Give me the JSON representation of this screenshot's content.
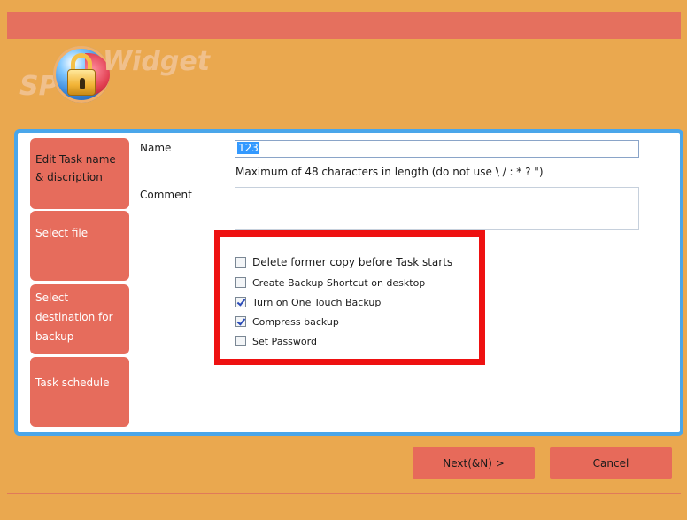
{
  "logo": {
    "text_left": "SP",
    "text_right": "Widget",
    "icon": "lock-icon"
  },
  "sidebar": {
    "items": [
      {
        "label": "Edit Task name & discription",
        "active": true
      },
      {
        "label": "Select file",
        "active": false
      },
      {
        "label": "Select destination for backup",
        "active": false
      },
      {
        "label": "Task schedule",
        "active": false
      }
    ]
  },
  "form": {
    "name_label": "Name",
    "name_value": "123",
    "name_hint": "Maximum of 48 characters in length (do not use \\ / : * ? \")",
    "comment_label": "Comment",
    "comment_value": ""
  },
  "options": [
    {
      "label": "Delete former copy before Task starts",
      "checked": false
    },
    {
      "label": "Create Backup Shortcut on desktop",
      "checked": false
    },
    {
      "label": "Turn on One Touch Backup",
      "checked": true
    },
    {
      "label": "Compress backup",
      "checked": true
    },
    {
      "label": "Set Password",
      "checked": false
    }
  ],
  "buttons": {
    "next": "Next(&N) >",
    "cancel": "Cancel"
  },
  "colors": {
    "background": "#eaa84f",
    "topbar": "#e5705e",
    "sidebar_item": "#e66c5c",
    "panel_border": "#4aa6ea",
    "highlight": "#ee1111"
  }
}
